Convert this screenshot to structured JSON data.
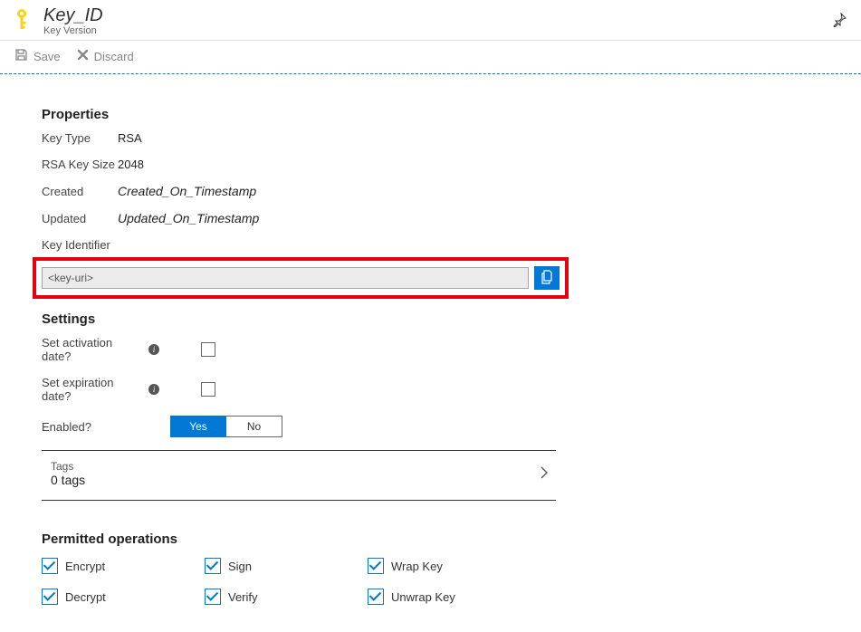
{
  "header": {
    "title": "Key_ID",
    "subtitle": "Key Version"
  },
  "toolbar": {
    "save_label": "Save",
    "discard_label": "Discard"
  },
  "properties": {
    "heading": "Properties",
    "key_type_label": "Key Type",
    "key_type_value": "RSA",
    "key_size_label": "RSA Key Size",
    "key_size_value": "2048",
    "created_label": "Created",
    "created_value": "Created_On_Timestamp",
    "updated_label": "Updated",
    "updated_value": "Updated_On_Timestamp",
    "key_identifier_label": "Key Identifier",
    "key_uri_value": "<key-uri>"
  },
  "settings": {
    "heading": "Settings",
    "activation_label": "Set activation date?",
    "expiration_label": "Set expiration date?",
    "enabled_label": "Enabled?",
    "yes_label": "Yes",
    "no_label": "No"
  },
  "tags": {
    "label": "Tags",
    "count_text": "0 tags"
  },
  "permitted": {
    "heading": "Permitted operations",
    "encrypt": "Encrypt",
    "decrypt": "Decrypt",
    "sign": "Sign",
    "verify": "Verify",
    "wrap": "Wrap Key",
    "unwrap": "Unwrap Key"
  }
}
